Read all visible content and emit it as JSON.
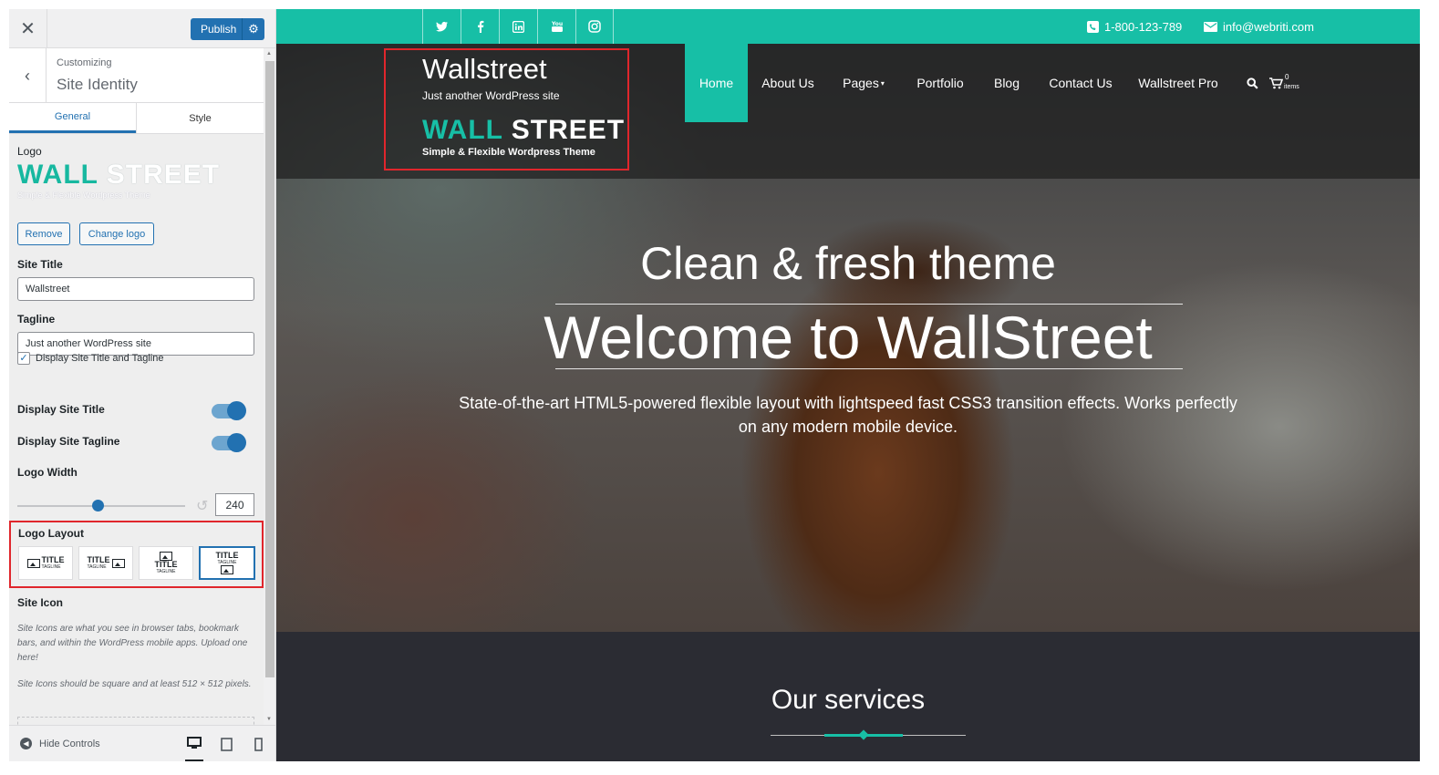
{
  "customizer": {
    "publish_label": "Publish",
    "breadcrumb": "Customizing",
    "section_title": "Site Identity",
    "tabs": [
      {
        "label": "General",
        "active": true
      },
      {
        "label": "Style",
        "active": false
      }
    ],
    "logo": {
      "label": "Logo",
      "preview_word_1": "WALL",
      "preview_word_2": "STREET",
      "preview_tagline": "Simple & Flexible Wordpress Theme",
      "remove_label": "Remove",
      "change_label": "Change logo"
    },
    "site_title": {
      "label": "Site Title",
      "value": "Wallstreet"
    },
    "tagline": {
      "label": "Tagline",
      "value": "Just another WordPress site"
    },
    "display_both": {
      "label": "Display Site Title and Tagline",
      "checked": true
    },
    "display_title": {
      "label": "Display Site Title",
      "on": true
    },
    "display_tagline": {
      "label": "Display Site Tagline",
      "on": true
    },
    "logo_width": {
      "label": "Logo Width",
      "value": "240",
      "slider_fraction": 0.5
    },
    "logo_layout": {
      "label": "Logo Layout",
      "title_word": "TITLE",
      "tagline_word": "TAGLINE",
      "selected_index": 3
    },
    "site_icon": {
      "label": "Site Icon",
      "desc_1": "Site Icons are what you see in browser tabs, bookmark bars, and within the WordPress mobile apps. Upload one here!",
      "desc_2": "Site Icons should be square and at least 512 × 512 pixels."
    },
    "hide_controls_label": "Hide Controls",
    "accent_color": "#2271b1"
  },
  "preview": {
    "accent_color": "#17bfa6",
    "social_icons": [
      "twitter-icon",
      "facebook-icon",
      "linkedin-icon",
      "youtube-icon",
      "instagram-icon"
    ],
    "phone": "1-800-123-789",
    "email": "info@webriti.com",
    "site_title": "Wallstreet",
    "site_tagline": "Just another WordPress site",
    "logo_word_1": "WALL",
    "logo_word_2": "STREET",
    "logo_tagline": "Simple & Flexible Wordpress Theme",
    "nav": [
      "Home",
      "About Us",
      "Pages",
      "Portfolio",
      "Blog",
      "Contact Us",
      "Wallstreet Pro"
    ],
    "cart_count": "0",
    "cart_label": "items",
    "hero_line_1": "Clean & fresh theme",
    "hero_line_2": "Welcome to WallStreet",
    "hero_text": "State-of-the-art HTML5-powered flexible layout with lightspeed fast CSS3 transition effects. Works perfectly on any modern mobile device.",
    "services_title": "Our services"
  }
}
